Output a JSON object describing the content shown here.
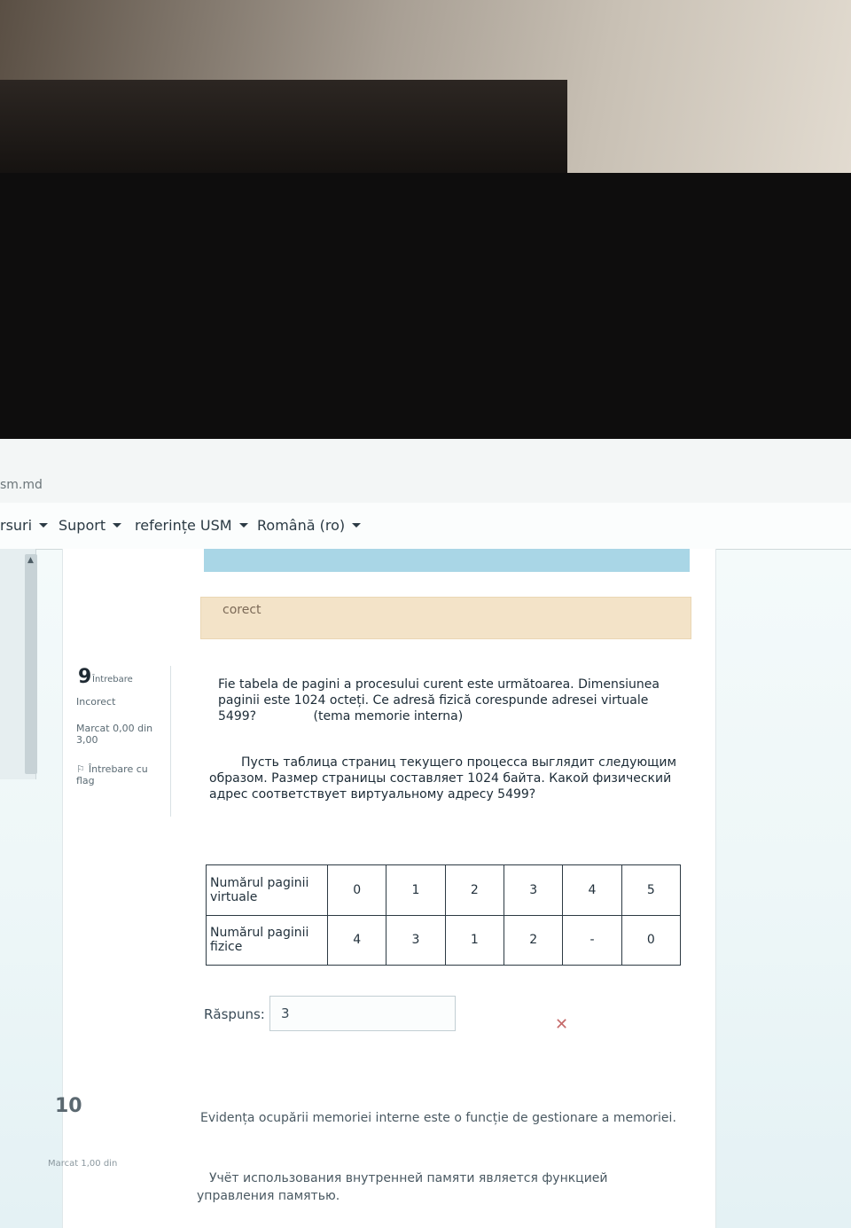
{
  "browser": {
    "url_fragment": "sm.md"
  },
  "navbar": {
    "items": [
      {
        "label": "rsuri"
      },
      {
        "label": "Suport"
      },
      {
        "label": "referințe USM"
      },
      {
        "label": "Română (ro)"
      }
    ]
  },
  "previous_feedback": {
    "text": "corect"
  },
  "question9": {
    "number": "9",
    "label": "Întrebare",
    "status": "Incorect",
    "mark": "Marcat 0,00 din 3,00",
    "flag": "Întrebare cu flag",
    "text_ro": "Fie tabela de pagini a procesului curent este următoarea. Dimensiunea paginii este 1024 octeți. Ce adresă fizică corespunde adresei virtuale 5499?",
    "tag": "(tema memorie interna)",
    "text_ru": "Пусть таблица страниц текущего процесса выглядит следующим образом. Размер страницы составляет 1024 байта. Какой физический адрес соответствует виртуальному адресу 5499?",
    "table": {
      "row1_label": "Numărul paginii virtuale",
      "row1_values": [
        "0",
        "1",
        "2",
        "3",
        "4",
        "5"
      ],
      "row2_label": "Numărul paginii fizice",
      "row2_values": [
        "4",
        "3",
        "1",
        "2",
        "-",
        "0"
      ]
    },
    "answer_label": "Răspuns:",
    "answer_value": "3",
    "answer_mark": "✕"
  },
  "question10": {
    "number": "10",
    "mark": "Marcat 1,00 din",
    "text_ro": "Evidența ocupării memoriei interne este o funcție de gestionare a memoriei.",
    "text_ru": "Учёт использования внутренней памяти является функцией управления памятью."
  }
}
